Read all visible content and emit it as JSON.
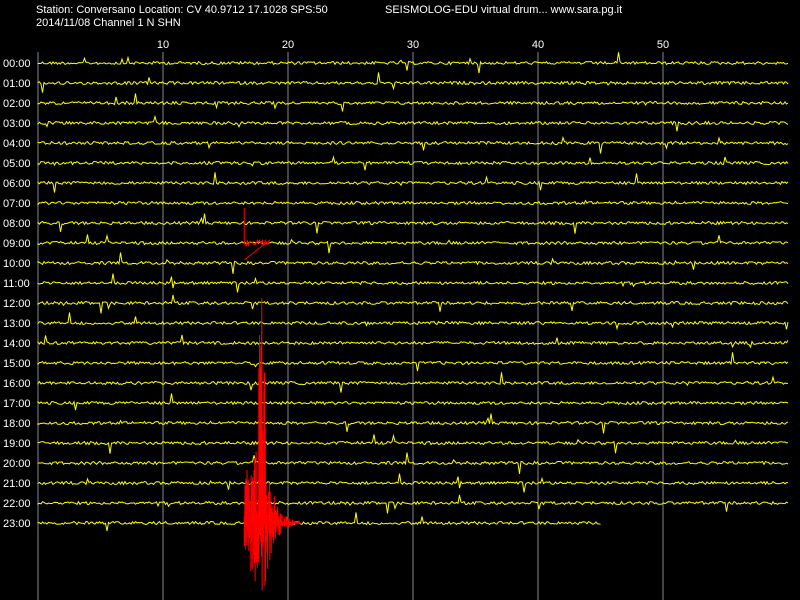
{
  "header": {
    "station_line": "Station: Conversano Location: CV 40.9712 17.1028 SPS:50",
    "date_line": "2014/11/08  Channel 1 N SHN",
    "title": "SEISMOLOG-EDU virtual drum... www.sara.pg.it"
  },
  "chart_data": {
    "type": "line",
    "subtype": "helicorder",
    "x_ticks": [
      "10",
      "20",
      "30",
      "40",
      "50"
    ],
    "x_tick_values": [
      10,
      20,
      30,
      40,
      50
    ],
    "xlim": [
      0,
      60
    ],
    "row_labels": [
      "00:00",
      "01:00",
      "02:00",
      "03:00",
      "04:00",
      "05:00",
      "06:00",
      "07:00",
      "08:00",
      "09:00",
      "10:00",
      "11:00",
      "12:00",
      "13:00",
      "14:00",
      "15:00",
      "16:00",
      "17:00",
      "18:00",
      "19:00",
      "20:00",
      "21:00",
      "22:00",
      "23:00"
    ],
    "last_row_end_minute": 45,
    "grid": "vertical",
    "colors": {
      "background": "#000000",
      "trace": "#ffff00",
      "event": "#ff0000",
      "grid": "#888888",
      "text": "#ffffff"
    },
    "events": [
      {
        "row": "23:00",
        "start_minute": 16.5,
        "end_minute": 21,
        "color": "#ff0000"
      },
      {
        "row": "09:00",
        "start_minute": 16.5,
        "end_minute": 18.5,
        "color": "#ff0000"
      }
    ]
  }
}
